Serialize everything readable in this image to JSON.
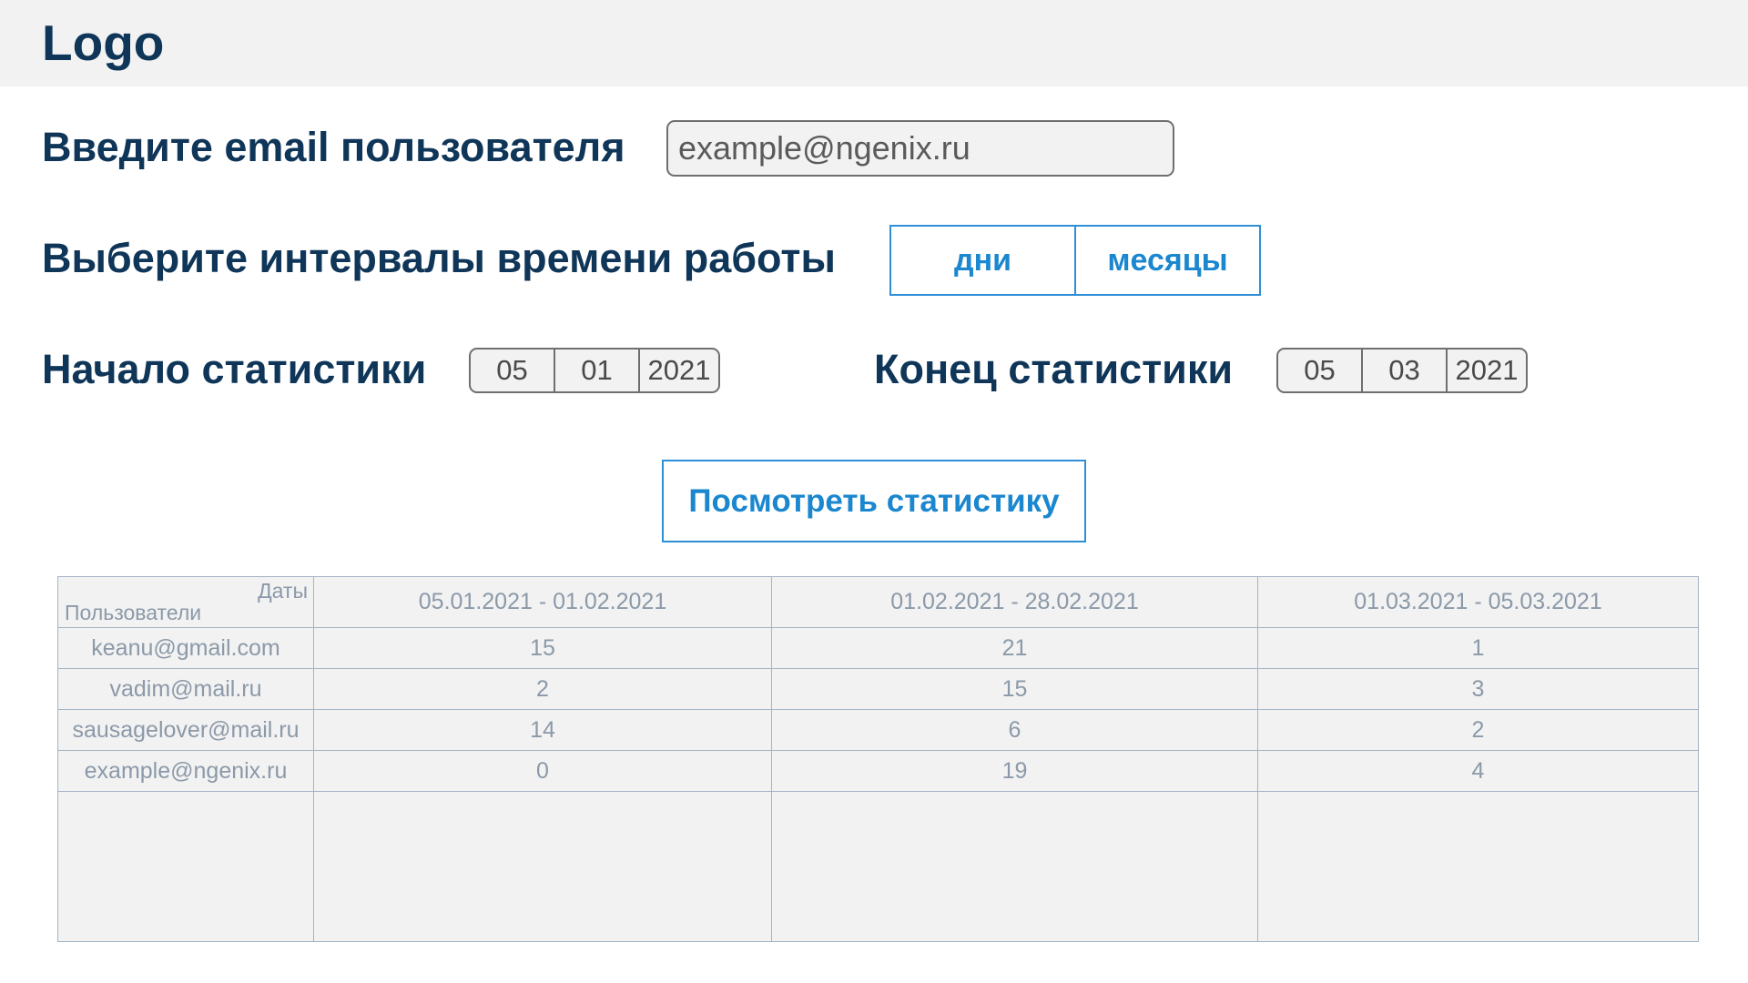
{
  "header": {
    "logo": "Logo"
  },
  "email": {
    "label": "Введите email пользователя",
    "placeholder": "example@ngenix.ru",
    "value": ""
  },
  "interval": {
    "label": "Выберите интервалы времени работы",
    "options": [
      "дни",
      "месяцы"
    ]
  },
  "start_date": {
    "label": "Начало статистики",
    "day": "05",
    "month": "01",
    "year": "2021"
  },
  "end_date": {
    "label": "Конец статистики",
    "day": "05",
    "month": "03",
    "year": "2021"
  },
  "view_button": {
    "label": "Посмотреть статистику"
  },
  "table": {
    "corner_top": "Даты",
    "corner_bottom": "Пользователи",
    "columns": [
      "05.01.2021 - 01.02.2021",
      "01.02.2021 - 28.02.2021",
      "01.03.2021 - 05.03.2021"
    ],
    "rows": [
      {
        "user": "keanu@gmail.com",
        "values": [
          "15",
          "21",
          "1"
        ]
      },
      {
        "user": "vadim@mail.ru",
        "values": [
          "2",
          "15",
          "3"
        ]
      },
      {
        "user": "sausagelover@mail.ru",
        "values": [
          "14",
          "6",
          "2"
        ]
      },
      {
        "user": "example@ngenix.ru",
        "values": [
          "0",
          "19",
          "4"
        ]
      }
    ]
  },
  "colors": {
    "heading": "#0f3658",
    "accent": "#1b87cf",
    "table_text": "#8b99a8",
    "panel_bg": "#f2f2f2"
  }
}
